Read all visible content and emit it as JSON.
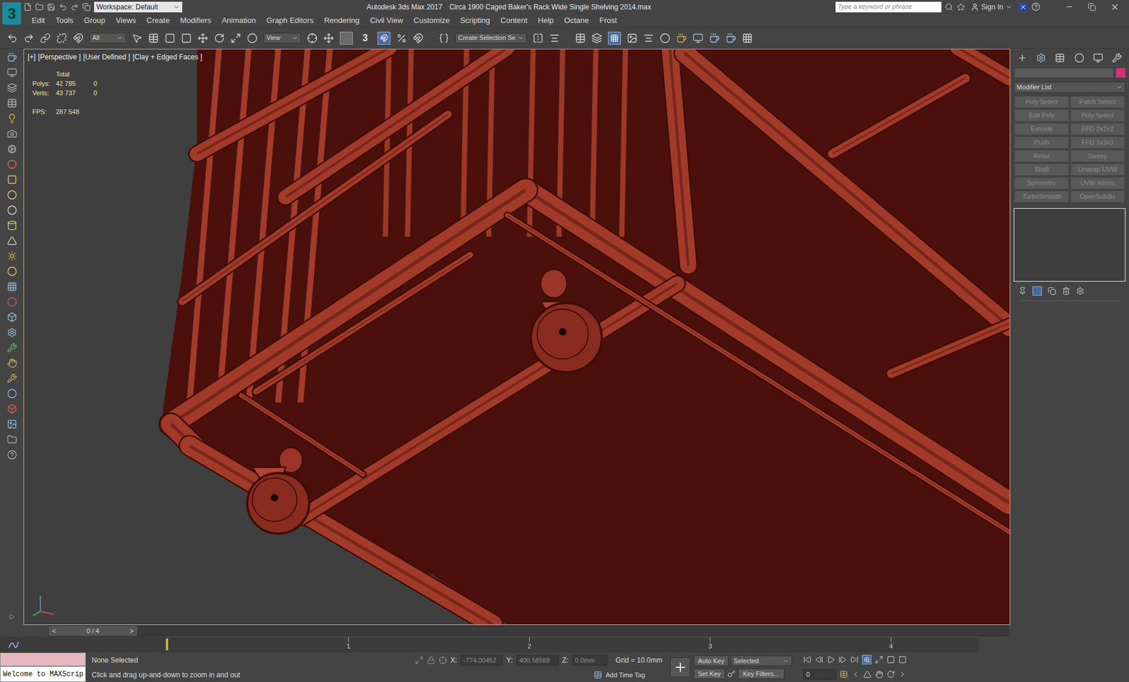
{
  "window": {
    "logo": "3",
    "workspace": "Workspace: Default",
    "app": "Autodesk 3ds Max 2017",
    "file": "Circa 1900 Caged Baker's Rack Wide Single Shelving 2014.max",
    "search_placeholder": "Type a keyword or phrase",
    "sign_in": "Sign In"
  },
  "menu": [
    "Edit",
    "Tools",
    "Group",
    "Views",
    "Create",
    "Modifiers",
    "Animation",
    "Graph Editors",
    "Rendering",
    "Civil View",
    "Customize",
    "Scripting",
    "Content",
    "Help",
    "Octane",
    "Frost"
  ],
  "toolbar": {
    "selection_filter": "All",
    "reference_coord": "View",
    "snap_label": "3",
    "named_selection": "Create Selection Se"
  },
  "viewport": {
    "labels": [
      "[+]",
      "[Perspective ]",
      "[User Defined ]",
      "[Clay + Edged Faces ]"
    ],
    "active": true,
    "stats": {
      "header": "Total",
      "rows": [
        {
          "label": "Polys:",
          "total": "42 785",
          "selected": "0"
        },
        {
          "label": "Verts:",
          "total": "43 737",
          "selected": "0"
        }
      ],
      "fps_label": "FPS:",
      "fps": "287.548"
    }
  },
  "command_panel": {
    "name": "",
    "modifier_list": "Modifier List",
    "buttons": [
      {
        "label": "Poly Select",
        "disabled": true
      },
      {
        "label": "Patch Select",
        "disabled": true
      },
      {
        "label": "Edit Poly",
        "disabled": true
      },
      {
        "label": "Poly Select",
        "disabled": true
      },
      {
        "label": "Extrude",
        "disabled": true
      },
      {
        "label": "FFD 2x2x2",
        "disabled": true
      },
      {
        "label": "Push",
        "disabled": true
      },
      {
        "label": "FFD 3x3x3",
        "disabled": true
      },
      {
        "label": "Relax",
        "disabled": true
      },
      {
        "label": "Sweep",
        "disabled": true
      },
      {
        "label": "Shell",
        "disabled": true
      },
      {
        "label": "Unwrap UVW",
        "disabled": true
      },
      {
        "label": "Symmetry",
        "disabled": true
      },
      {
        "label": "UVW Xform",
        "disabled": true
      },
      {
        "label": "TurboSmooth",
        "disabled": true
      },
      {
        "label": "OpenSubdiv",
        "disabled": true
      }
    ]
  },
  "time_slider": {
    "prev": "<",
    "label": "0 / 4",
    "next": ">",
    "level": 0
  },
  "track_bar": {
    "ticks": [
      "1",
      "2",
      "3",
      "4"
    ]
  },
  "status_bar": {
    "listener": "Welcome to MAXScrip",
    "selection": "None Selected",
    "prompt": "Click and drag up-and-down to zoom in and out",
    "x_label": "X:",
    "x": "-774.00452",
    "y_label": "Y:",
    "y": "400.58588",
    "z_label": "Z:",
    "z": "0.0mm",
    "grid": "Grid = 10.0mm",
    "time_tag": "Add Time Tag",
    "auto_key": "Auto Key",
    "key_mode": "Selected",
    "set_key": "Set Key",
    "key_filters": "Key Filters...",
    "frame": "0"
  }
}
